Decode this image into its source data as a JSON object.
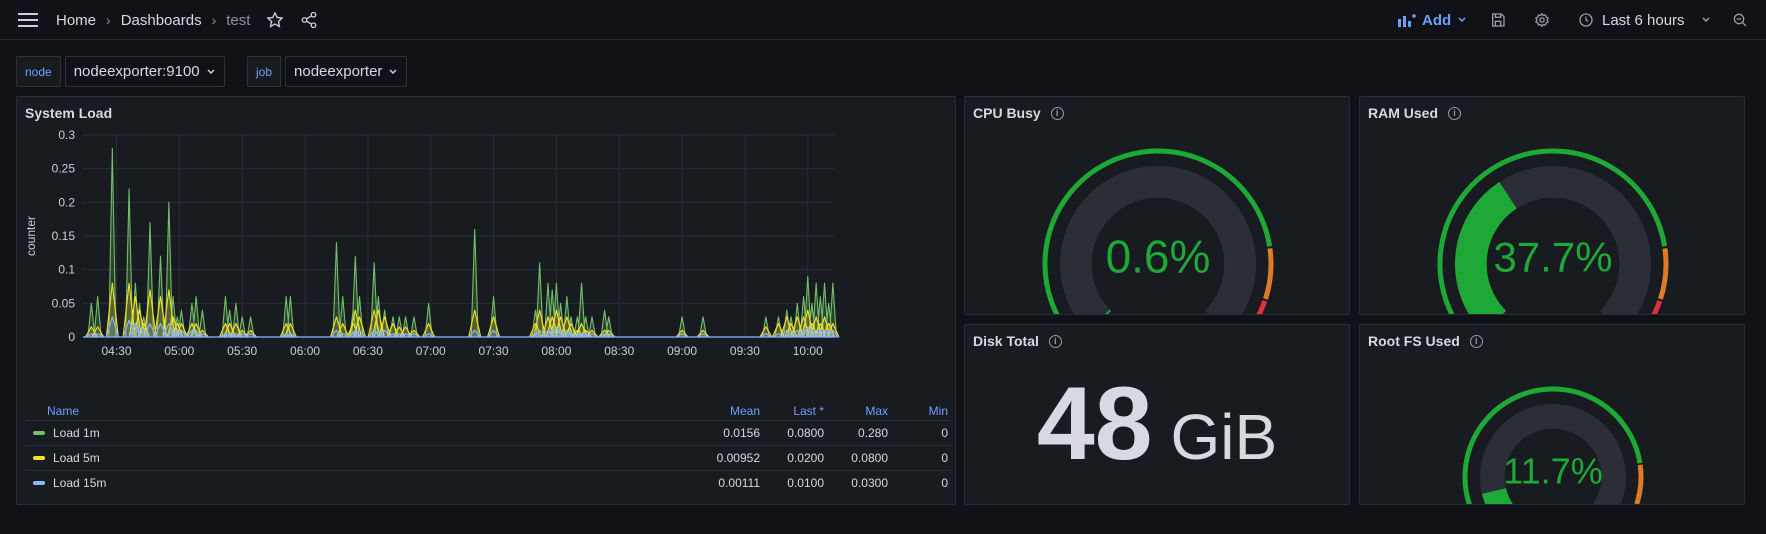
{
  "topbar": {
    "breadcrumb": [
      "Home",
      "Dashboards",
      "test"
    ],
    "add_label": "Add",
    "time_range": "Last 6 hours"
  },
  "variables": [
    {
      "label": "node",
      "value": "nodeexporter:9100"
    },
    {
      "label": "job",
      "value": "nodeexporter"
    }
  ],
  "panels": {
    "system_load": {
      "title": "System Load",
      "ylabel": "counter",
      "legend_headers": {
        "name": "Name",
        "mean": "Mean",
        "last": "Last *",
        "max": "Max",
        "min": "Min"
      },
      "legend": [
        {
          "name": "Load 1m",
          "color": "#73bf69",
          "mean": "0.0156",
          "last": "0.0800",
          "max": "0.280",
          "min": "0"
        },
        {
          "name": "Load 5m",
          "color": "#fade2a",
          "mean": "0.00952",
          "last": "0.0200",
          "max": "0.0800",
          "min": "0"
        },
        {
          "name": "Load 15m",
          "color": "#8ab8ff",
          "mean": "0.00111",
          "last": "0.0100",
          "max": "0.0300",
          "min": "0"
        }
      ]
    },
    "cpu_busy": {
      "title": "CPU Busy",
      "value": 0.6,
      "display": "0.6%"
    },
    "ram_used": {
      "title": "RAM Used",
      "value": 37.7,
      "display": "37.7%"
    },
    "disk_total": {
      "title": "Disk Total",
      "value": "48",
      "unit": "GiB"
    },
    "root_fs": {
      "title": "Root FS Used",
      "value": 11.7,
      "display": "11.7%"
    }
  },
  "colors": {
    "green": "#1ea836",
    "orange": "#e07a26",
    "red": "#e0303f",
    "accent": "#6e9fff"
  },
  "chart_data": {
    "type": "area",
    "title": "System Load",
    "xlabel": "",
    "ylabel": "counter",
    "ylim": [
      0,
      0.3
    ],
    "x_ticks": [
      "04:30",
      "05:00",
      "05:30",
      "06:00",
      "06:30",
      "07:00",
      "07:30",
      "08:00",
      "08:30",
      "09:00",
      "09:30",
      "10:00"
    ],
    "y_ticks": [
      "0",
      "0.05",
      "0.1",
      "0.15",
      "0.2",
      "0.25",
      "0.3"
    ],
    "x": [
      "04:18",
      "04:21",
      "04:28",
      "04:36",
      "04:39",
      "04:41",
      "04:43",
      "04:46",
      "04:51",
      "04:55",
      "04:57",
      "04:59",
      "05:01",
      "05:06",
      "05:08",
      "05:11",
      "05:22",
      "05:24",
      "05:27",
      "05:30",
      "05:34",
      "05:51",
      "05:53",
      "06:15",
      "06:18",
      "06:23",
      "06:24",
      "06:26",
      "06:33",
      "06:35",
      "06:38",
      "06:42",
      "06:45",
      "06:48",
      "06:52",
      "06:59",
      "07:21",
      "07:30",
      "07:50",
      "07:52",
      "07:56",
      "07:58",
      "08:00",
      "08:02",
      "08:05",
      "08:07",
      "08:10",
      "08:12",
      "08:14",
      "08:17",
      "08:23",
      "08:25",
      "09:00",
      "09:10",
      "09:40",
      "09:46",
      "09:50",
      "09:52",
      "09:55",
      "09:58",
      "10:00",
      "10:02",
      "10:04",
      "10:06",
      "10:08",
      "10:10",
      "10:12"
    ],
    "series": [
      {
        "name": "Load 1m",
        "values": [
          0.05,
          0.06,
          0.28,
          0.22,
          0.08,
          0.05,
          0.03,
          0.17,
          0.12,
          0.2,
          0.06,
          0.03,
          0.04,
          0.05,
          0.06,
          0.04,
          0.06,
          0.04,
          0.05,
          0.03,
          0.03,
          0.06,
          0.06,
          0.14,
          0.06,
          0.04,
          0.12,
          0.06,
          0.11,
          0.06,
          0.04,
          0.03,
          0.03,
          0.03,
          0.03,
          0.05,
          0.16,
          0.06,
          0.04,
          0.11,
          0.08,
          0.07,
          0.08,
          0.05,
          0.06,
          0.03,
          0.03,
          0.08,
          0.03,
          0.03,
          0.04,
          0.03,
          0.03,
          0.03,
          0.03,
          0.03,
          0.04,
          0.03,
          0.05,
          0.06,
          0.09,
          0.05,
          0.08,
          0.06,
          0.08,
          0.05,
          0.08
        ]
      },
      {
        "name": "Load 5m",
        "values": [
          0.015,
          0.015,
          0.08,
          0.08,
          0.06,
          0.04,
          0.02,
          0.07,
          0.06,
          0.07,
          0.03,
          0.02,
          0.02,
          0.02,
          0.02,
          0.01,
          0.02,
          0.02,
          0.02,
          0.01,
          0.01,
          0.02,
          0.02,
          0.03,
          0.02,
          0.02,
          0.04,
          0.03,
          0.04,
          0.04,
          0.03,
          0.02,
          0.015,
          0.015,
          0.01,
          0.02,
          0.04,
          0.03,
          0.02,
          0.04,
          0.03,
          0.03,
          0.04,
          0.03,
          0.03,
          0.02,
          0.01,
          0.02,
          0.01,
          0.01,
          0.01,
          0.01,
          0.01,
          0.01,
          0.015,
          0.02,
          0.03,
          0.02,
          0.03,
          0.03,
          0.04,
          0.02,
          0.03,
          0.02,
          0.03,
          0.02,
          0.02
        ]
      },
      {
        "name": "Load 15m",
        "values": [
          0.005,
          0.005,
          0.03,
          0.025,
          0.02,
          0.015,
          0.01,
          0.02,
          0.02,
          0.02,
          0.01,
          0.01,
          0.01,
          0.01,
          0.01,
          0.005,
          0.005,
          0.005,
          0.005,
          0.005,
          0.005,
          0.005,
          0.005,
          0.01,
          0.005,
          0.005,
          0.01,
          0.01,
          0.01,
          0.01,
          0.01,
          0.005,
          0.005,
          0.005,
          0.005,
          0.005,
          0.01,
          0.01,
          0.005,
          0.01,
          0.01,
          0.01,
          0.015,
          0.01,
          0.01,
          0.005,
          0.005,
          0.005,
          0.005,
          0.005,
          0.005,
          0.005,
          0.005,
          0.005,
          0.005,
          0.005,
          0.01,
          0.005,
          0.01,
          0.01,
          0.015,
          0.01,
          0.01,
          0.01,
          0.01,
          0.01,
          0.01
        ]
      }
    ]
  }
}
